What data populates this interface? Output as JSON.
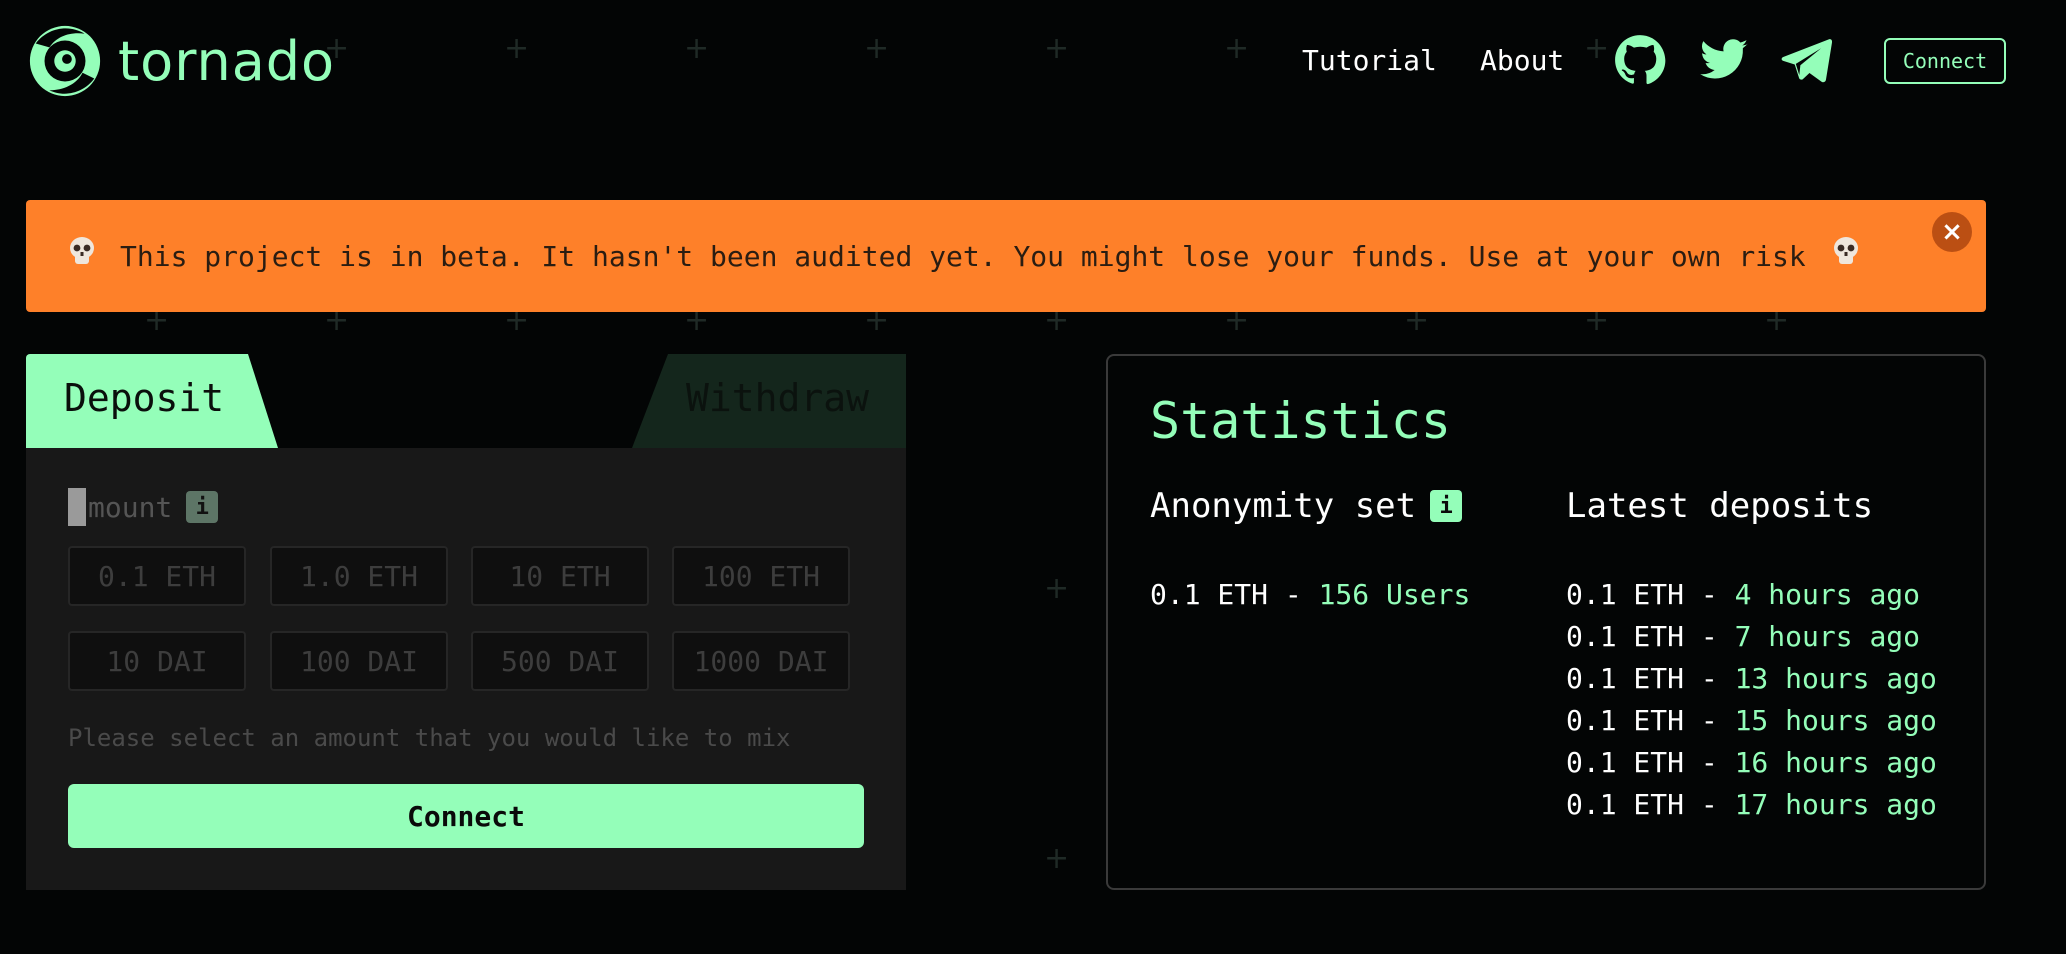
{
  "header": {
    "brand": "tornado",
    "nav": {
      "tutorial": "Tutorial",
      "about": "About"
    },
    "icons": [
      "github-icon",
      "twitter-icon",
      "telegram-icon"
    ],
    "connect_label": "Connect"
  },
  "banner": {
    "text": "This project is in beta. It hasn't been audited yet. You might lose your funds. Use at your own risk",
    "close": "×"
  },
  "tabs": {
    "deposit": "Deposit",
    "withdraw": "Withdraw"
  },
  "deposit": {
    "amount_label": "mount",
    "info": "i",
    "eth_amounts": [
      "0.1 ETH",
      "1.0 ETH",
      "10 ETH",
      "100 ETH"
    ],
    "dai_amounts": [
      "10 DAI",
      "100 DAI",
      "500 DAI",
      "1000 DAI"
    ],
    "hint": "Please select an amount that you would like to mix",
    "connect_label": "Connect"
  },
  "statistics": {
    "title": "Statistics",
    "anonymity_label": "Anonymity set",
    "info": "i",
    "latest_label": "Latest deposits",
    "anonymity": {
      "amount": "0.1 ETH - ",
      "users": "156 Users"
    },
    "deposits": [
      {
        "amount": "0.1 ETH - ",
        "time": "4 hours ago"
      },
      {
        "amount": "0.1 ETH - ",
        "time": "7 hours ago"
      },
      {
        "amount": "0.1 ETH - ",
        "time": "13 hours ago"
      },
      {
        "amount": "0.1 ETH - ",
        "time": "15 hours ago"
      },
      {
        "amount": "0.1 ETH - ",
        "time": "16 hours ago"
      },
      {
        "amount": "0.1 ETH - ",
        "time": "17 hours ago"
      }
    ]
  },
  "colors": {
    "accent": "#94feb9",
    "warning": "#fe8029",
    "background": "#030505",
    "panel": "#181818"
  }
}
